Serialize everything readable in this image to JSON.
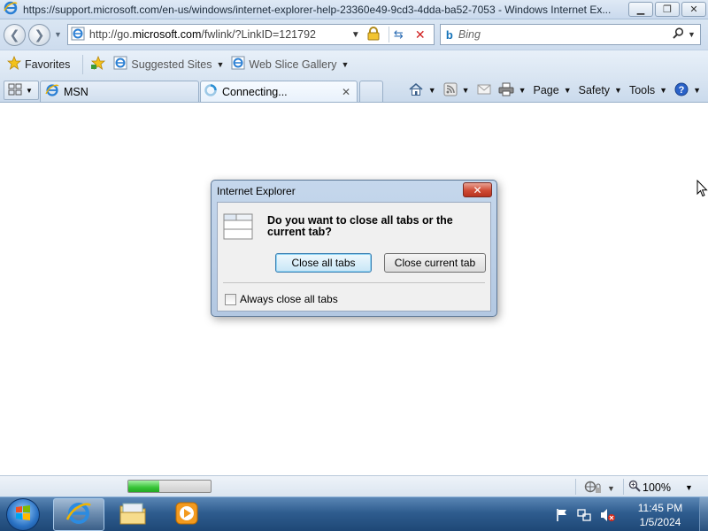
{
  "window": {
    "title": "https://support.microsoft.com/en-us/windows/internet-explorer-help-23360e49-9cd3-4dda-ba52-7053 - Windows Internet Ex..."
  },
  "address_bar": {
    "url_prefix": "http://go.",
    "url_domain": "microsoft.com",
    "url_suffix": "/fwlink/?LinkID=121792"
  },
  "search": {
    "placeholder": "Bing"
  },
  "favorites_bar": {
    "favorites_label": "Favorites",
    "items": [
      {
        "label": "Suggested Sites"
      },
      {
        "label": "Web Slice Gallery"
      }
    ]
  },
  "tabs": [
    {
      "label": "MSN"
    },
    {
      "label": "Connecting..."
    }
  ],
  "command_bar": {
    "page": "Page",
    "safety": "Safety",
    "tools": "Tools"
  },
  "status_bar": {
    "progress": 0.38,
    "zoom": "100%"
  },
  "dialog": {
    "title": "Internet Explorer",
    "question": "Do you want to close all tabs or the current tab?",
    "close_all": "Close all tabs",
    "close_current": "Close current tab",
    "checkbox_label": "Always close all tabs",
    "checkbox_checked": false
  },
  "taskbar": {
    "time": "11:45 PM",
    "date": "1/5/2024"
  },
  "colors": {
    "accent": "#2f5d8f",
    "progress_green": "#37c437",
    "dialog_close": "#cf4b35"
  }
}
